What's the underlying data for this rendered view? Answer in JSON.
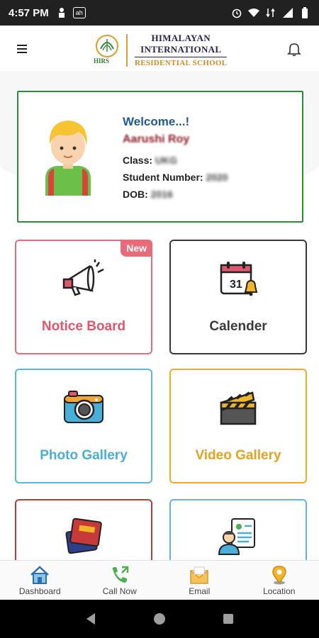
{
  "status_bar": {
    "time": "4:57 PM",
    "notif_icons": [
      "person-icon",
      "square-app-icon"
    ],
    "system_icons": [
      "alarm-icon",
      "wifi-icon",
      "data-icon",
      "signal-icon",
      "battery-icon"
    ]
  },
  "header": {
    "logo_emblem_text": "HIRS",
    "logo_line1": "HIMALAYAN",
    "logo_line2": "INTERNATIONAL",
    "logo_line3": "RESIDENTIAL SCHOOL"
  },
  "profile": {
    "welcome": "Welcome...!",
    "name": "Aarushi Roy",
    "class_label": "Class:",
    "class_value": "UKG",
    "student_number_label": "Student Number:",
    "student_number_value": "2020",
    "dob_label": "DOB:",
    "dob_value": "2016"
  },
  "tiles": [
    {
      "label": "Notice Board",
      "color": "#e0566b",
      "badge": "New",
      "icon": "megaphone-icon"
    },
    {
      "label": "Calender",
      "color": "#3a3a3a",
      "icon": "calendar-icon",
      "icon_text": "31"
    },
    {
      "label": "Photo Gallery",
      "color": "#4aafd8",
      "icon": "camera-icon"
    },
    {
      "label": "Video Gallery",
      "color": "#e6a21e",
      "icon": "clapperboard-icon"
    },
    {
      "label": "",
      "color": "#c03a3a",
      "icon": "books-icon"
    },
    {
      "label": "",
      "color": "#4aafd8",
      "icon": "profile-document-icon"
    }
  ],
  "bottom_nav": [
    {
      "label": "Dashboard",
      "icon": "home-icon"
    },
    {
      "label": "Call Now",
      "icon": "phone-icon"
    },
    {
      "label": "Email",
      "icon": "mail-icon"
    },
    {
      "label": "Location",
      "icon": "location-pin-icon"
    }
  ],
  "system_nav": [
    "back-icon",
    "home-circle-icon",
    "recents-icon"
  ]
}
